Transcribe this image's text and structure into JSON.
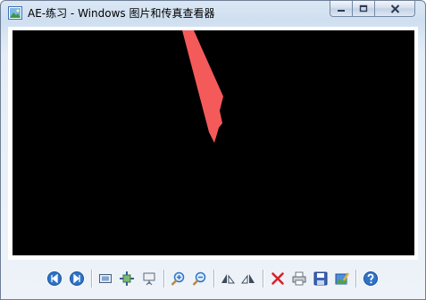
{
  "window": {
    "title": "AE-练习 - Windows 图片和传真查看器",
    "app_icon": "picture-viewer-icon"
  },
  "caption_buttons": [
    "minimize-icon",
    "maximize-icon",
    "close-icon"
  ],
  "image": {
    "background": "#000000",
    "shape_color": "#f45a5a"
  },
  "toolbar": {
    "buttons": [
      "previous-image-icon",
      "next-image-icon",
      "best-fit-icon",
      "actual-size-icon",
      "slideshow-icon",
      "zoom-in-icon",
      "zoom-out-icon",
      "rotate-clockwise-icon",
      "rotate-counterclockwise-icon",
      "delete-icon",
      "print-icon",
      "save-copy-icon",
      "open-for-editing-icon",
      "help-icon"
    ]
  }
}
